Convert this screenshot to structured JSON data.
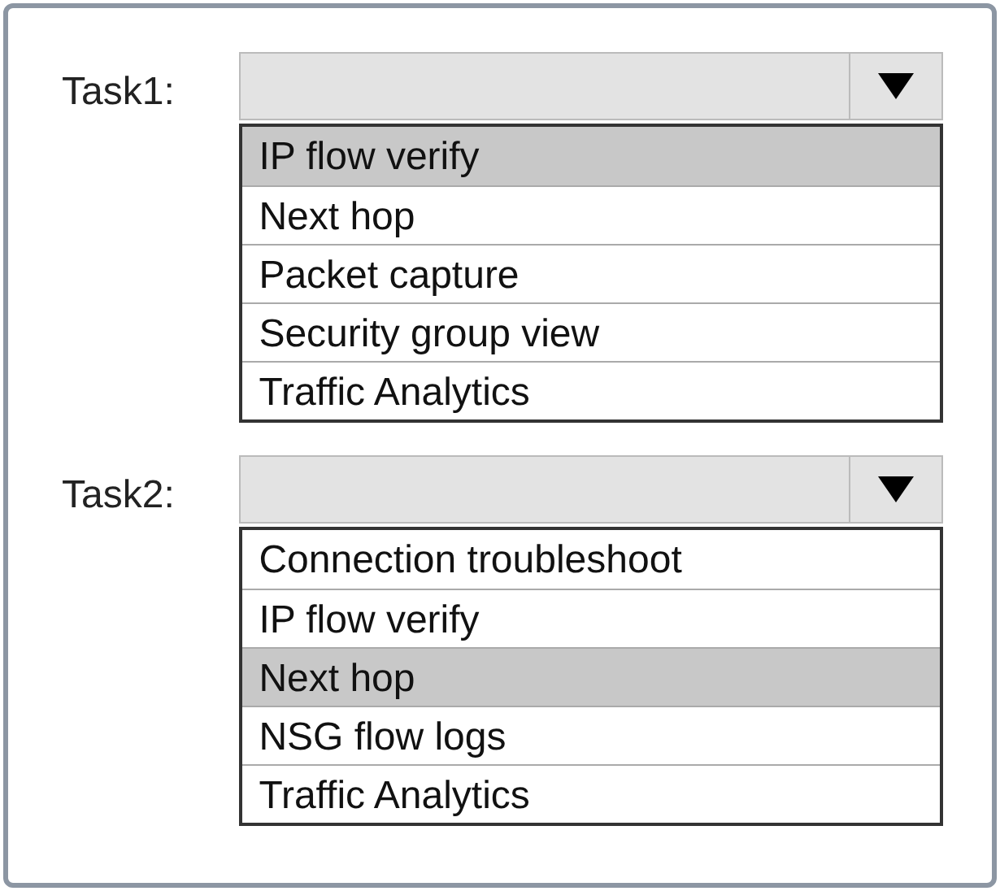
{
  "tasks": [
    {
      "label": "Task1:",
      "options": [
        {
          "text": "IP flow verify",
          "selected": true
        },
        {
          "text": "Next hop",
          "selected": false
        },
        {
          "text": "Packet capture",
          "selected": false
        },
        {
          "text": "Security group view",
          "selected": false
        },
        {
          "text": "Traffic Analytics",
          "selected": false
        }
      ]
    },
    {
      "label": "Task2:",
      "options": [
        {
          "text": "Connection troubleshoot",
          "selected": false
        },
        {
          "text": "IP flow verify",
          "selected": false
        },
        {
          "text": "Next hop",
          "selected": true
        },
        {
          "text": "NSG flow logs",
          "selected": false
        },
        {
          "text": "Traffic Analytics",
          "selected": false
        }
      ]
    }
  ]
}
